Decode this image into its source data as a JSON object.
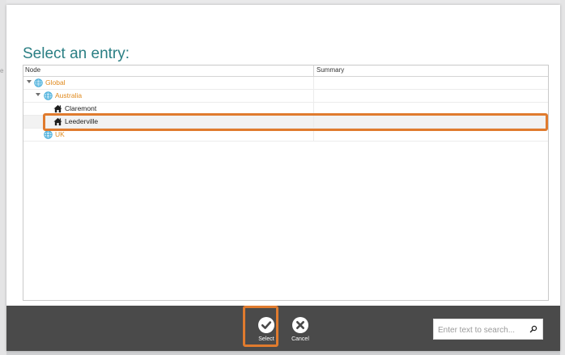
{
  "background": {
    "left_hint": "e"
  },
  "dialog": {
    "title": "Select an entry:",
    "grid": {
      "columns": {
        "node": "Node",
        "summary": "Summary"
      },
      "rows": [
        {
          "label": "Global",
          "icon": "globe-icon",
          "level": 0,
          "expanded": true
        },
        {
          "label": "Australia",
          "icon": "globe-icon",
          "level": 1,
          "expanded": true
        },
        {
          "label": "Claremont",
          "icon": "home-icon",
          "level": 2
        },
        {
          "label": "Leederville",
          "icon": "home-icon",
          "level": 2,
          "selected": true
        },
        {
          "label": "UK",
          "icon": "globe-icon",
          "level": 1
        }
      ]
    }
  },
  "toolbar": {
    "select_label": "Select",
    "cancel_label": "Cancel",
    "search_placeholder": "Enter text to search..."
  },
  "colors": {
    "title": "#2b7f84",
    "group_label": "#e08a1e",
    "highlight": "#e07b2e",
    "toolbar_bg": "#4a4a4a",
    "globe": "#3aa8d8"
  }
}
